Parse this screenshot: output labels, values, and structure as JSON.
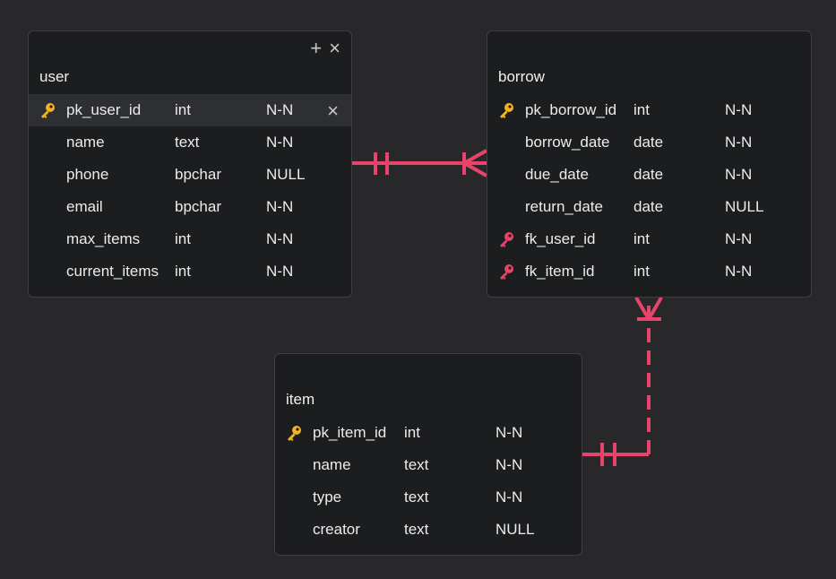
{
  "colors": {
    "relationship": "#e8436a",
    "primary_key": "#f2b522",
    "foreign_key": "#e8436a",
    "table_bg": "#1c1d1f",
    "canvas_bg": "#28282b"
  },
  "toolbar": {
    "add_icon": "plus-icon",
    "close_icon": "close-icon"
  },
  "tables": {
    "user": {
      "name": "user",
      "columns": [
        {
          "name": "pk_user_id",
          "type": "int",
          "null": "N-N",
          "key": "primary"
        },
        {
          "name": "name",
          "type": "text",
          "null": "N-N"
        },
        {
          "name": "phone",
          "type": "bpchar",
          "null": "NULL"
        },
        {
          "name": "email",
          "type": "bpchar",
          "null": "N-N"
        },
        {
          "name": "max_items",
          "type": "int",
          "null": "N-N"
        },
        {
          "name": "current_items",
          "type": "int",
          "null": "N-N"
        }
      ]
    },
    "borrow": {
      "name": "borrow",
      "columns": [
        {
          "name": "pk_borrow_id",
          "type": "int",
          "null": "N-N",
          "key": "primary"
        },
        {
          "name": "borrow_date",
          "type": "date",
          "null": "N-N"
        },
        {
          "name": "due_date",
          "type": "date",
          "null": "N-N"
        },
        {
          "name": "return_date",
          "type": "date",
          "null": "NULL"
        },
        {
          "name": "fk_user_id",
          "type": "int",
          "null": "N-N",
          "key": "foreign"
        },
        {
          "name": "fk_item_id",
          "type": "int",
          "null": "N-N",
          "key": "foreign"
        }
      ]
    },
    "item": {
      "name": "item",
      "columns": [
        {
          "name": "pk_item_id",
          "type": "int",
          "null": "N-N",
          "key": "primary"
        },
        {
          "name": "name",
          "type": "text",
          "null": "N-N"
        },
        {
          "name": "type",
          "type": "text",
          "null": "N-N"
        },
        {
          "name": "creator",
          "type": "text",
          "null": "NULL"
        }
      ]
    }
  },
  "relationships": [
    {
      "from": "user",
      "to": "borrow",
      "from_cardinality": "one-and-only-one",
      "to_cardinality": "one-or-many",
      "line": "solid"
    },
    {
      "from": "item",
      "to": "borrow",
      "from_cardinality": "one-and-only-one",
      "to_cardinality": "one-or-many",
      "line": "dashed"
    }
  ]
}
